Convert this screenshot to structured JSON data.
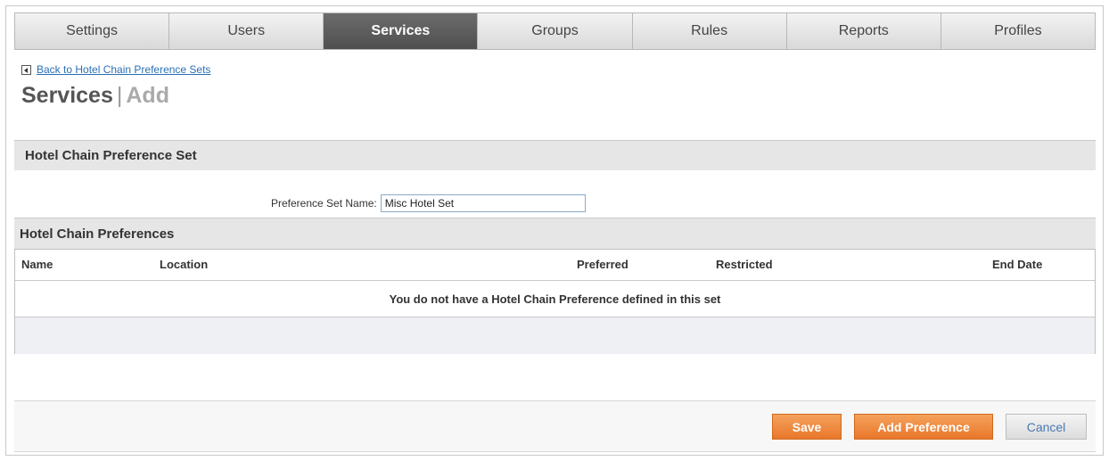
{
  "tabs": [
    {
      "label": "Settings",
      "active": false
    },
    {
      "label": "Users",
      "active": false
    },
    {
      "label": "Services",
      "active": true
    },
    {
      "label": "Groups",
      "active": false
    },
    {
      "label": "Rules",
      "active": false
    },
    {
      "label": "Reports",
      "active": false
    },
    {
      "label": "Profiles",
      "active": false
    }
  ],
  "back_link": {
    "label": "Back to Hotel Chain Preference Sets",
    "icon": "back-arrow-icon"
  },
  "page_title": {
    "main": "Services",
    "separator": "|",
    "sub": "Add"
  },
  "section_set": {
    "title": "Hotel Chain Preference Set"
  },
  "form": {
    "name_label": "Preference Set Name:",
    "name_value": "Misc Hotel Set"
  },
  "section_prefs": {
    "title": "Hotel Chain Preferences"
  },
  "table": {
    "columns": [
      "Name",
      "Location",
      "Preferred",
      "Restricted",
      "End Date"
    ],
    "empty_message": "You do not have a Hotel Chain Preference defined in this set"
  },
  "buttons": {
    "save": "Save",
    "add_preference": "Add Preference",
    "cancel": "Cancel"
  },
  "colors": {
    "active_tab": "#595959",
    "link": "#2a6fb5",
    "primary_button": "#ed8534"
  }
}
